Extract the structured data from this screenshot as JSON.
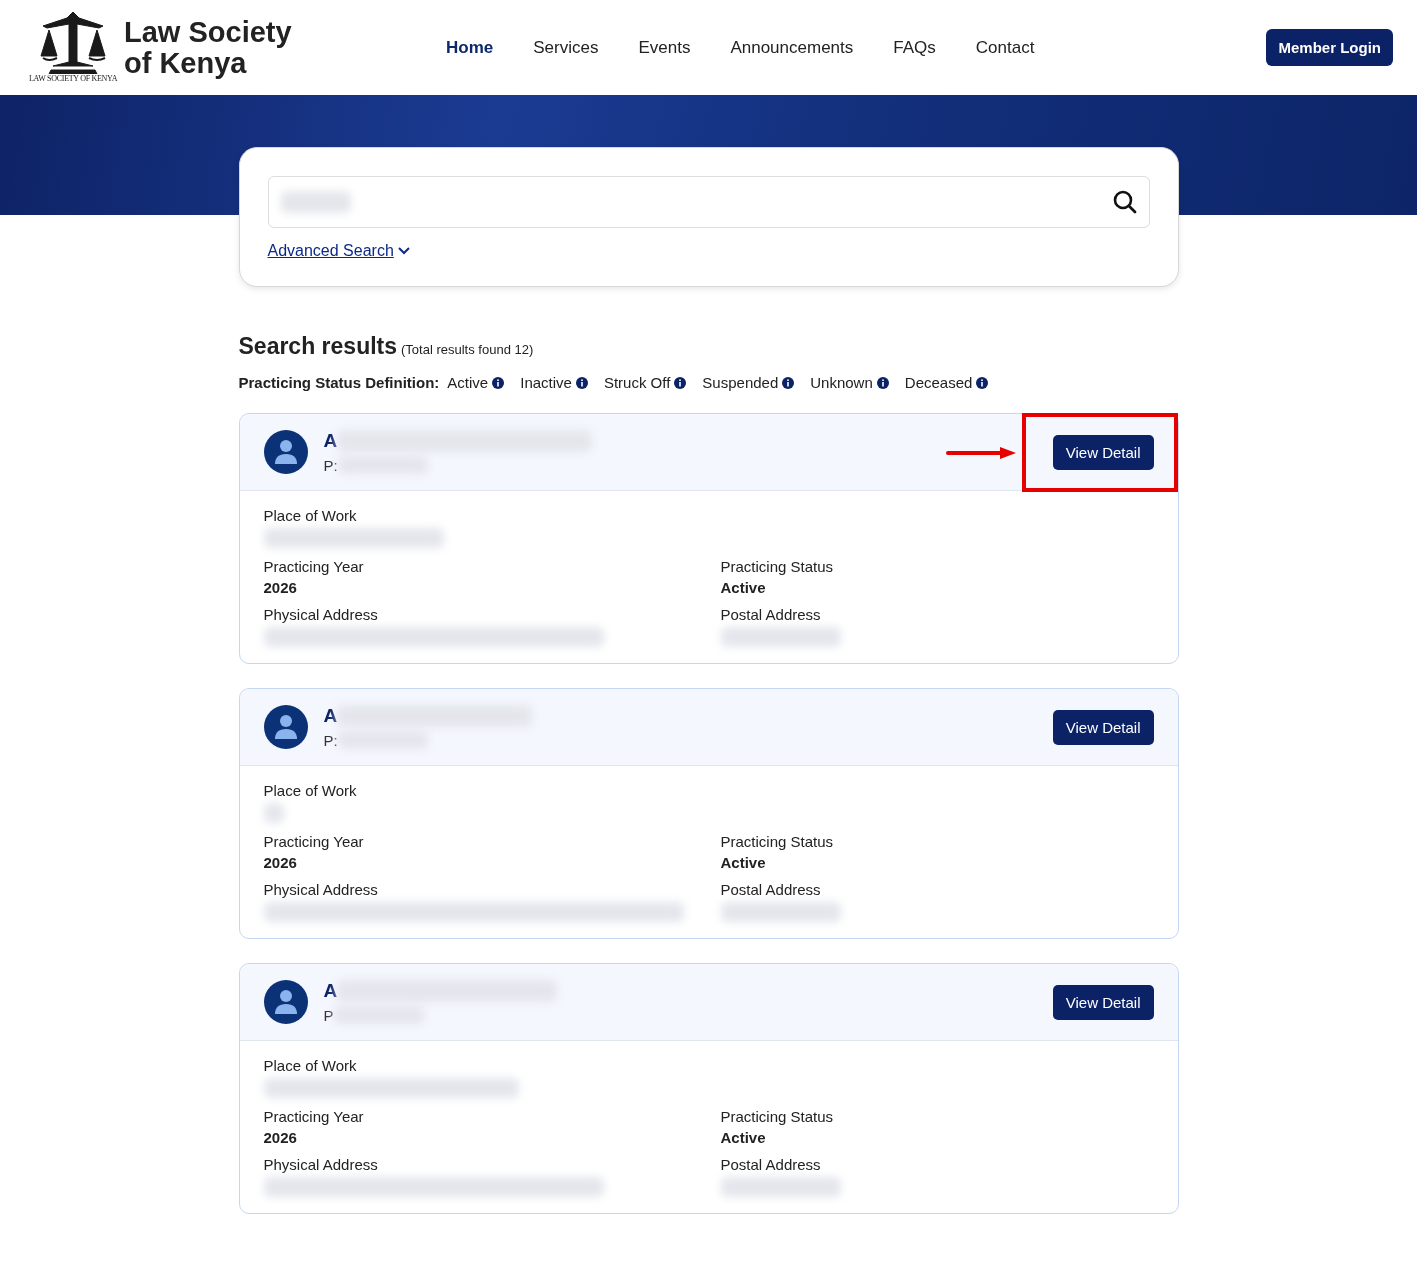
{
  "header": {
    "logo_title": "Law Society of Kenya",
    "logo_caption": "LAW SOCIETY OF KENYA",
    "nav": [
      {
        "label": "Home",
        "selected": true
      },
      {
        "label": "Services",
        "selected": false
      },
      {
        "label": "Events",
        "selected": false
      },
      {
        "label": "Announcements",
        "selected": false
      },
      {
        "label": "FAQs",
        "selected": false
      },
      {
        "label": "Contact",
        "selected": false
      }
    ],
    "login": "Member Login"
  },
  "search": {
    "advanced": "Advanced Search"
  },
  "results": {
    "title": "Search results",
    "count": "(Total results found 12)",
    "legend_label": "Practicing Status Definition:",
    "statuses": [
      "Active",
      "Inactive",
      "Struck Off",
      "Suspended",
      "Unknown",
      "Deceased"
    ]
  },
  "cards": [
    {
      "name": "A",
      "prefix": "P:",
      "highlighted": true,
      "button": "View Detail",
      "work_label": "Place of Work",
      "year_label": "Practicing Year",
      "year": "2026",
      "status_label": "Practicing Status",
      "status": "Active",
      "physical_label": "Physical Address",
      "postal_label": "Postal Address"
    },
    {
      "name": "A",
      "prefix": "P:",
      "highlighted": false,
      "button": "View Detail",
      "work_label": "Place of Work",
      "year_label": "Practicing Year",
      "year": "2026",
      "status_label": "Practicing Status",
      "status": "Active",
      "physical_label": "Physical Address",
      "postal_label": "Postal Address"
    },
    {
      "name": "A",
      "prefix": "P",
      "highlighted": false,
      "button": "View Detail",
      "work_label": "Place of Work",
      "year_label": "Practicing Year",
      "year": "2026",
      "status_label": "Practicing Status",
      "status": "Active",
      "physical_label": "Physical Address",
      "postal_label": "Postal Address"
    }
  ]
}
